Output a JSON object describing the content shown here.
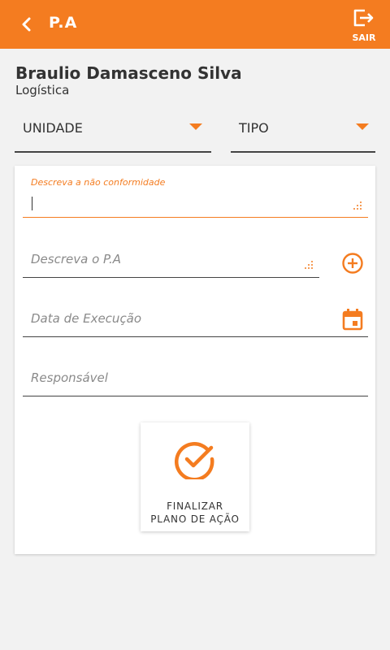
{
  "header": {
    "title": "P.A",
    "logout_label": "SAIR",
    "back_icon": "chevron-left-icon",
    "logout_icon": "logout-icon",
    "accent_color": "#f47c20"
  },
  "user": {
    "name": "Braulio Damasceno Silva",
    "department": "Logística"
  },
  "filters": {
    "unidade": "UNIDADE",
    "tipo": "TIPO"
  },
  "form": {
    "nonconformity_label": "Descreva a não conformidade",
    "nonconformity_value": "",
    "pa_placeholder": "Descreva o P.A",
    "date_placeholder": "Data de Execução",
    "responsible_placeholder": "Responsável",
    "add_icon": "add-circle-icon",
    "calendar_icon": "calendar-icon"
  },
  "finalize": {
    "line1": "FINALIZAR",
    "line2": "PLANO DE AÇÃO",
    "icon": "check-circle-icon"
  }
}
